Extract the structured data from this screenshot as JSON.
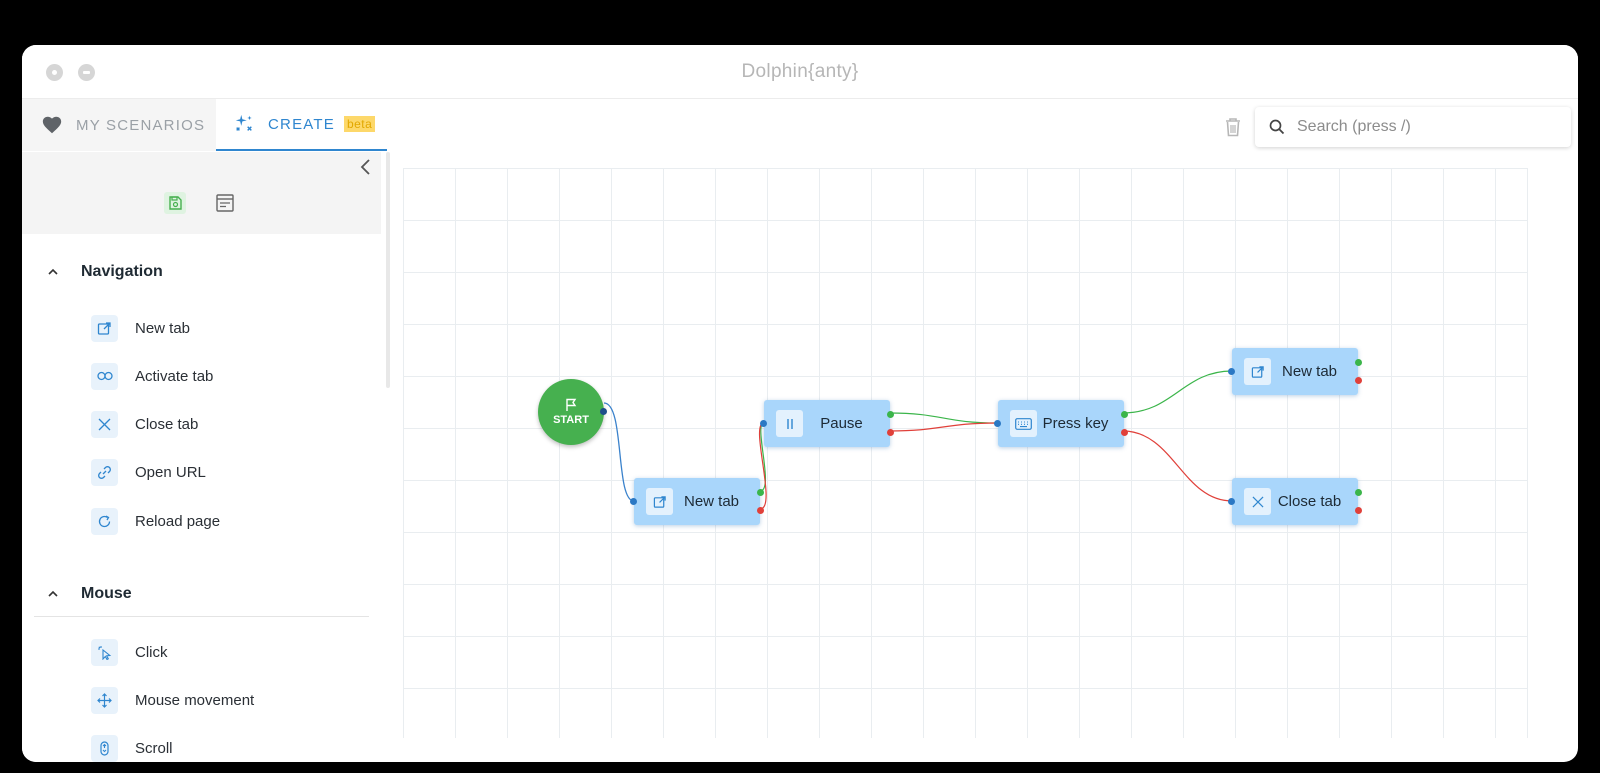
{
  "window": {
    "title": "Dolphin{anty}"
  },
  "tabs": {
    "my_scenarios": "MY SCENARIOS",
    "create": "CREATE",
    "beta_badge": "beta"
  },
  "search": {
    "placeholder": "Search (press /)"
  },
  "sidebar": {
    "sections": [
      {
        "title": "Navigation",
        "items": [
          {
            "label": "New tab",
            "icon": "open-external-icon"
          },
          {
            "label": "Activate tab",
            "icon": "link-chain-icon"
          },
          {
            "label": "Close tab",
            "icon": "close-icon"
          },
          {
            "label": "Open URL",
            "icon": "link-icon"
          },
          {
            "label": "Reload page",
            "icon": "reload-icon"
          }
        ]
      },
      {
        "title": "Mouse",
        "items": [
          {
            "label": "Click",
            "icon": "cursor-click-icon"
          },
          {
            "label": "Mouse movement",
            "icon": "move-arrows-icon"
          },
          {
            "label": "Scroll",
            "icon": "mouse-scroll-icon"
          }
        ]
      }
    ]
  },
  "canvas": {
    "start_label": "START",
    "nodes": {
      "new_tab_1": "New tab",
      "pause": "Pause",
      "press_key": "Press key",
      "new_tab_2": "New tab",
      "close_tab": "Close tab"
    }
  },
  "colors": {
    "accent": "#2f86cf",
    "node_bg": "#a9d6fb",
    "start": "#46b04f",
    "success_port": "#3bb54a",
    "error_port": "#e0403a",
    "beta_badge": "#fdd86a"
  }
}
